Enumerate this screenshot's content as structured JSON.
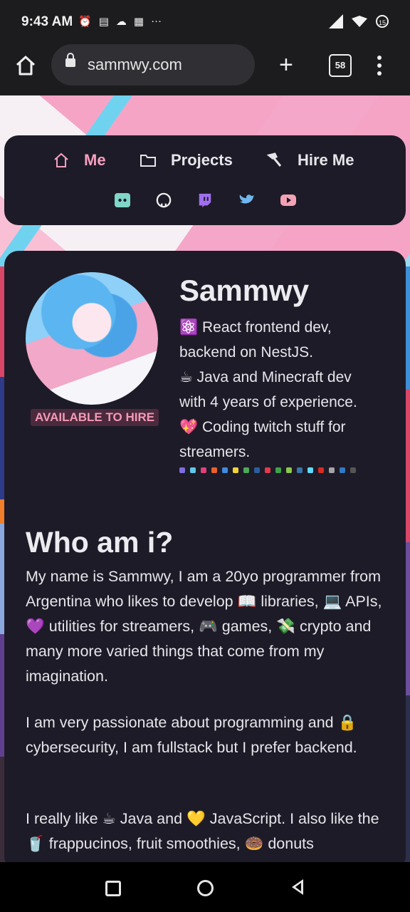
{
  "status": {
    "time": "9:43 AM",
    "battery": "15"
  },
  "browser": {
    "url": "sammwy.com",
    "tab_count": "58"
  },
  "nav": {
    "items": [
      {
        "label": "Me",
        "active": true
      },
      {
        "label": "Projects",
        "active": false
      },
      {
        "label": "Hire Me",
        "active": false
      }
    ],
    "social": [
      "discord-icon",
      "github-icon",
      "twitch-icon",
      "twitter-icon",
      "youtube-icon"
    ]
  },
  "profile": {
    "name": "Sammwy",
    "badge": "AVAILABLE TO HIRE",
    "bio_lines": [
      "⚛️ React frontend dev,",
      "backend on NestJS.",
      "☕ Java and Minecraft dev",
      "with 4 years of experience.",
      "💖 Coding twitch stuff for",
      "streamers."
    ]
  },
  "about": {
    "heading": "Who am i?",
    "paragraphs": [
      "My name is Sammwy, I am a 20yo programmer from Argentina who likes to develop 📖 libraries, 💻 APIs, 💜 utilities for streamers, 🎮 games, 💸 crypto and many more varied things that come from my imagination.",
      "I am very passionate about programming and 🔒 cybersecurity, I am fullstack but I prefer backend.",
      "I really like ☕ Java and 💛 JavaScript. I also like the 🥤 frappucinos, fruit smoothies, 🍩 donuts"
    ]
  },
  "colors": {
    "accent": "#f6a0c0",
    "card": "#1d1b27"
  }
}
